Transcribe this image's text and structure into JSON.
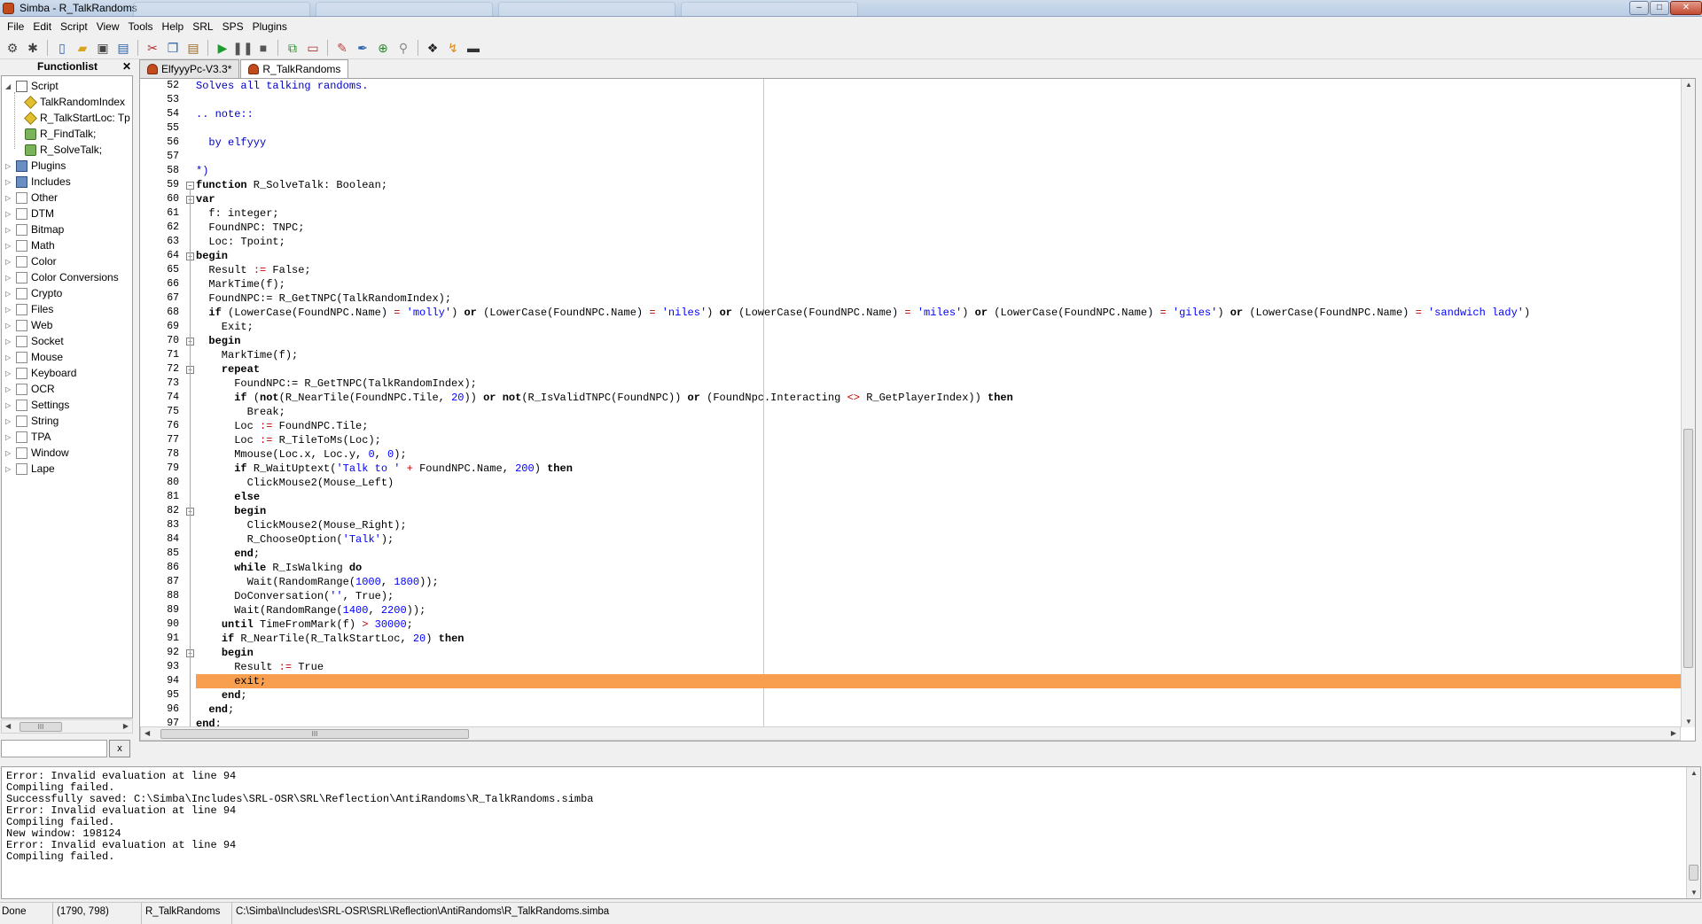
{
  "window": {
    "title": "Simba - R_TalkRandoms",
    "minimize": "–",
    "maximize": "□",
    "close": "✕"
  },
  "menu": [
    "File",
    "Edit",
    "Script",
    "View",
    "Tools",
    "Help",
    "SRL",
    "SPS",
    "Plugins"
  ],
  "toolbar": [
    "gear-icon",
    "bug-icon",
    "new-file-icon",
    "open-folder-icon",
    "save-icon",
    "save-all-icon",
    "cut-icon",
    "copy-icon",
    "paste-icon",
    "run-icon",
    "pause-icon",
    "stop-icon",
    "select-client-icon",
    "target-window-icon",
    "color-picker-icon",
    "eyedropper-icon",
    "globe-icon",
    "binoculars-icon",
    "sps-icon",
    "extra-icon",
    "console-icon"
  ],
  "sidebar": {
    "title": "Functionlist",
    "close_label": "✕",
    "tree": [
      {
        "label": "Script",
        "level": 0,
        "icon": "script",
        "expanded": true
      },
      {
        "label": "TalkRandomIndex",
        "level": 1,
        "icon": "func"
      },
      {
        "label": "R_TalkStartLoc: Tp",
        "level": 1,
        "icon": "func"
      },
      {
        "label": "R_FindTalk;",
        "level": 1,
        "icon": "proc"
      },
      {
        "label": "R_SolveTalk;",
        "level": 1,
        "icon": "proc"
      },
      {
        "label": "Plugins",
        "level": 0,
        "icon": "book"
      },
      {
        "label": "Includes",
        "level": 0,
        "icon": "book"
      },
      {
        "label": "Other",
        "level": 0,
        "icon": "page"
      },
      {
        "label": "DTM",
        "level": 0,
        "icon": "page"
      },
      {
        "label": "Bitmap",
        "level": 0,
        "icon": "page"
      },
      {
        "label": "Math",
        "level": 0,
        "icon": "page"
      },
      {
        "label": "Color",
        "level": 0,
        "icon": "page"
      },
      {
        "label": "Color Conversions",
        "level": 0,
        "icon": "page"
      },
      {
        "label": "Crypto",
        "level": 0,
        "icon": "page"
      },
      {
        "label": "Files",
        "level": 0,
        "icon": "page"
      },
      {
        "label": "Web",
        "level": 0,
        "icon": "page"
      },
      {
        "label": "Socket",
        "level": 0,
        "icon": "page"
      },
      {
        "label": "Mouse",
        "level": 0,
        "icon": "page"
      },
      {
        "label": "Keyboard",
        "level": 0,
        "icon": "page"
      },
      {
        "label": "OCR",
        "level": 0,
        "icon": "page"
      },
      {
        "label": "Settings",
        "level": 0,
        "icon": "page"
      },
      {
        "label": "String",
        "level": 0,
        "icon": "page"
      },
      {
        "label": "TPA",
        "level": 0,
        "icon": "page"
      },
      {
        "label": "Window",
        "level": 0,
        "icon": "page"
      },
      {
        "label": "Lape",
        "level": 0,
        "icon": "page"
      }
    ],
    "filter_value": "",
    "filter_clear": "x",
    "scroll_grip": "III"
  },
  "tabs": [
    {
      "label": "ElfyyyPc-V3.3*",
      "active": false
    },
    {
      "label": "R_TalkRandoms",
      "active": true
    }
  ],
  "editor": {
    "current_line": 94,
    "fold_lines": [
      59,
      60,
      64,
      70,
      72,
      82,
      92
    ],
    "scroll_grip": "III",
    "lines": [
      {
        "n": 52,
        "c": [
          [
            "cm",
            "Solves all talking randoms."
          ]
        ]
      },
      {
        "n": 53,
        "c": []
      },
      {
        "n": 54,
        "c": [
          [
            "cm",
            ".. note::"
          ]
        ]
      },
      {
        "n": 55,
        "c": []
      },
      {
        "n": 56,
        "c": [
          [
            "cm",
            "  by elfyyy"
          ]
        ]
      },
      {
        "n": 57,
        "c": []
      },
      {
        "n": 58,
        "c": [
          [
            "cm",
            "*)"
          ]
        ]
      },
      {
        "n": 59,
        "c": [
          [
            "kw",
            "function"
          ],
          [
            "",
            " R_SolveTalk: Boolean;"
          ]
        ]
      },
      {
        "n": 60,
        "c": [
          [
            "kw",
            "var"
          ]
        ]
      },
      {
        "n": 61,
        "c": [
          [
            "",
            "  f: integer;"
          ]
        ]
      },
      {
        "n": 62,
        "c": [
          [
            "",
            "  FoundNPC: TNPC;"
          ]
        ]
      },
      {
        "n": 63,
        "c": [
          [
            "",
            "  Loc: Tpoint;"
          ]
        ]
      },
      {
        "n": 64,
        "c": [
          [
            "kw",
            "begin"
          ]
        ]
      },
      {
        "n": 65,
        "c": [
          [
            "",
            "  Result "
          ],
          [
            "sym",
            ":="
          ],
          [
            "",
            " False;"
          ]
        ]
      },
      {
        "n": 66,
        "c": [
          [
            "",
            "  MarkTime(f);"
          ]
        ]
      },
      {
        "n": 67,
        "c": [
          [
            "",
            "  FoundNPC:= R_GetTNPC(TalkRandomIndex);"
          ]
        ]
      },
      {
        "n": 68,
        "c": [
          [
            "",
            "  "
          ],
          [
            "kw",
            "if"
          ],
          [
            "",
            " (LowerCase(FoundNPC.Name) "
          ],
          [
            "sym",
            "="
          ],
          [
            "",
            " "
          ],
          [
            "str",
            "'molly'"
          ],
          [
            "",
            ") "
          ],
          [
            "kw",
            "or"
          ],
          [
            "",
            " (LowerCase(FoundNPC.Name) "
          ],
          [
            "sym",
            "="
          ],
          [
            "",
            " "
          ],
          [
            "str",
            "'niles'"
          ],
          [
            "",
            ") "
          ],
          [
            "kw",
            "or"
          ],
          [
            "",
            " (LowerCase(FoundNPC.Name) "
          ],
          [
            "sym",
            "="
          ],
          [
            "",
            " "
          ],
          [
            "str",
            "'miles'"
          ],
          [
            "",
            ") "
          ],
          [
            "kw",
            "or"
          ],
          [
            "",
            " (LowerCase(FoundNPC.Name) "
          ],
          [
            "sym",
            "="
          ],
          [
            "",
            " "
          ],
          [
            "str",
            "'giles'"
          ],
          [
            "",
            ") "
          ],
          [
            "kw",
            "or"
          ],
          [
            "",
            " (LowerCase(FoundNPC.Name) "
          ],
          [
            "sym",
            "="
          ],
          [
            "",
            " "
          ],
          [
            "str",
            "'sandwich lady'"
          ],
          [
            "",
            ")"
          ]
        ]
      },
      {
        "n": 69,
        "c": [
          [
            "",
            "    Exit;"
          ]
        ]
      },
      {
        "n": 70,
        "c": [
          [
            "",
            "  "
          ],
          [
            "kw",
            "begin"
          ]
        ]
      },
      {
        "n": 71,
        "c": [
          [
            "",
            "    MarkTime(f);"
          ]
        ]
      },
      {
        "n": 72,
        "c": [
          [
            "",
            "    "
          ],
          [
            "kw",
            "repeat"
          ]
        ]
      },
      {
        "n": 73,
        "c": [
          [
            "",
            "      FoundNPC:= R_GetTNPC(TalkRandomIndex);"
          ]
        ]
      },
      {
        "n": 74,
        "c": [
          [
            "",
            "      "
          ],
          [
            "kw",
            "if"
          ],
          [
            "",
            " ("
          ],
          [
            "kw",
            "not"
          ],
          [
            "",
            "(R_NearTile(FoundNPC.Tile, "
          ],
          [
            "num",
            "20"
          ],
          [
            "",
            ")) "
          ],
          [
            "kw",
            "or"
          ],
          [
            "",
            " "
          ],
          [
            "kw",
            "not"
          ],
          [
            "",
            "(R_IsValidTNPC(FoundNPC)) "
          ],
          [
            "kw",
            "or"
          ],
          [
            "",
            " (FoundNpc.Interacting "
          ],
          [
            "sym",
            "<>"
          ],
          [
            "",
            " R_GetPlayerIndex)) "
          ],
          [
            "kw",
            "then"
          ]
        ]
      },
      {
        "n": 75,
        "c": [
          [
            "",
            "        Break;"
          ]
        ]
      },
      {
        "n": 76,
        "c": [
          [
            "",
            "      Loc "
          ],
          [
            "sym",
            ":="
          ],
          [
            "",
            " FoundNPC.Tile;"
          ]
        ]
      },
      {
        "n": 77,
        "c": [
          [
            "",
            "      Loc "
          ],
          [
            "sym",
            ":="
          ],
          [
            "",
            " R_TileToMs(Loc);"
          ]
        ]
      },
      {
        "n": 78,
        "c": [
          [
            "",
            "      Mmouse(Loc.x, Loc.y, "
          ],
          [
            "num",
            "0"
          ],
          [
            "",
            ", "
          ],
          [
            "num",
            "0"
          ],
          [
            "",
            ");"
          ]
        ]
      },
      {
        "n": 79,
        "c": [
          [
            "",
            "      "
          ],
          [
            "kw",
            "if"
          ],
          [
            "",
            " R_WaitUptext("
          ],
          [
            "str",
            "'Talk to '"
          ],
          [
            "",
            " "
          ],
          [
            "sym",
            "+"
          ],
          [
            "",
            " FoundNPC.Name, "
          ],
          [
            "num",
            "200"
          ],
          [
            "",
            ") "
          ],
          [
            "kw",
            "then"
          ]
        ]
      },
      {
        "n": 80,
        "c": [
          [
            "",
            "        ClickMouse2(Mouse_Left)"
          ]
        ]
      },
      {
        "n": 81,
        "c": [
          [
            "",
            "      "
          ],
          [
            "kw",
            "else"
          ]
        ]
      },
      {
        "n": 82,
        "c": [
          [
            "",
            "      "
          ],
          [
            "kw",
            "begin"
          ]
        ]
      },
      {
        "n": 83,
        "c": [
          [
            "",
            "        ClickMouse2(Mouse_Right);"
          ]
        ]
      },
      {
        "n": 84,
        "c": [
          [
            "",
            "        R_ChooseOption("
          ],
          [
            "str",
            "'Talk'"
          ],
          [
            "",
            ");"
          ]
        ]
      },
      {
        "n": 85,
        "c": [
          [
            "",
            "      "
          ],
          [
            "kw",
            "end"
          ],
          [
            "",
            ";"
          ]
        ]
      },
      {
        "n": 86,
        "c": [
          [
            "",
            "      "
          ],
          [
            "kw",
            "while"
          ],
          [
            "",
            " R_IsWalking "
          ],
          [
            "kw",
            "do"
          ]
        ]
      },
      {
        "n": 87,
        "c": [
          [
            "",
            "        Wait(RandomRange("
          ],
          [
            "num",
            "1000"
          ],
          [
            "",
            ", "
          ],
          [
            "num",
            "1800"
          ],
          [
            "",
            "));"
          ]
        ]
      },
      {
        "n": 88,
        "c": [
          [
            "",
            "      DoConversation("
          ],
          [
            "str",
            "''"
          ],
          [
            "",
            ", True);"
          ]
        ]
      },
      {
        "n": 89,
        "c": [
          [
            "",
            "      Wait(RandomRange("
          ],
          [
            "num",
            "1400"
          ],
          [
            "",
            ", "
          ],
          [
            "num",
            "2200"
          ],
          [
            "",
            "));"
          ]
        ]
      },
      {
        "n": 90,
        "c": [
          [
            "",
            "    "
          ],
          [
            "kw",
            "until"
          ],
          [
            "",
            " TimeFromMark(f) "
          ],
          [
            "sym",
            ">"
          ],
          [
            "",
            " "
          ],
          [
            "num",
            "30000"
          ],
          [
            "",
            ";"
          ]
        ]
      },
      {
        "n": 91,
        "c": [
          [
            "",
            "    "
          ],
          [
            "kw",
            "if"
          ],
          [
            "",
            " R_NearTile(R_TalkStartLoc, "
          ],
          [
            "num",
            "20"
          ],
          [
            "",
            ") "
          ],
          [
            "kw",
            "then"
          ]
        ]
      },
      {
        "n": 92,
        "c": [
          [
            "",
            "    "
          ],
          [
            "kw",
            "begin"
          ]
        ]
      },
      {
        "n": 93,
        "c": [
          [
            "",
            "      Result "
          ],
          [
            "sym",
            ":="
          ],
          [
            "",
            " True"
          ]
        ]
      },
      {
        "n": 94,
        "c": [
          [
            "",
            "      exit;"
          ]
        ]
      },
      {
        "n": 95,
        "c": [
          [
            "",
            "    "
          ],
          [
            "kw",
            "end"
          ],
          [
            "",
            ";"
          ]
        ]
      },
      {
        "n": 96,
        "c": [
          [
            "",
            "  "
          ],
          [
            "kw",
            "end"
          ],
          [
            "",
            ";"
          ]
        ]
      },
      {
        "n": 97,
        "c": [
          [
            "kw",
            "end"
          ],
          [
            "",
            ";"
          ]
        ]
      }
    ]
  },
  "output": [
    "Error: Invalid evaluation at line 94",
    "Compiling failed.",
    "Successfully saved: C:\\Simba\\Includes\\SRL-OSR\\SRL\\Reflection\\AntiRandoms\\R_TalkRandoms.simba",
    "Error: Invalid evaluation at line 94",
    "Compiling failed.",
    "New window: 198124",
    "Error: Invalid evaluation at line 94",
    "Compiling failed."
  ],
  "status": {
    "state": "Done",
    "coords": "(1790, 798)",
    "script": "R_TalkRandoms",
    "path": "C:\\Simba\\Includes\\SRL-OSR\\SRL\\Reflection\\AntiRandoms\\R_TalkRandoms.simba"
  },
  "colors": {
    "current_line": "#f79f4f",
    "comment": "#0000c0",
    "string": "#0000ff",
    "symbol": "#c00000"
  }
}
